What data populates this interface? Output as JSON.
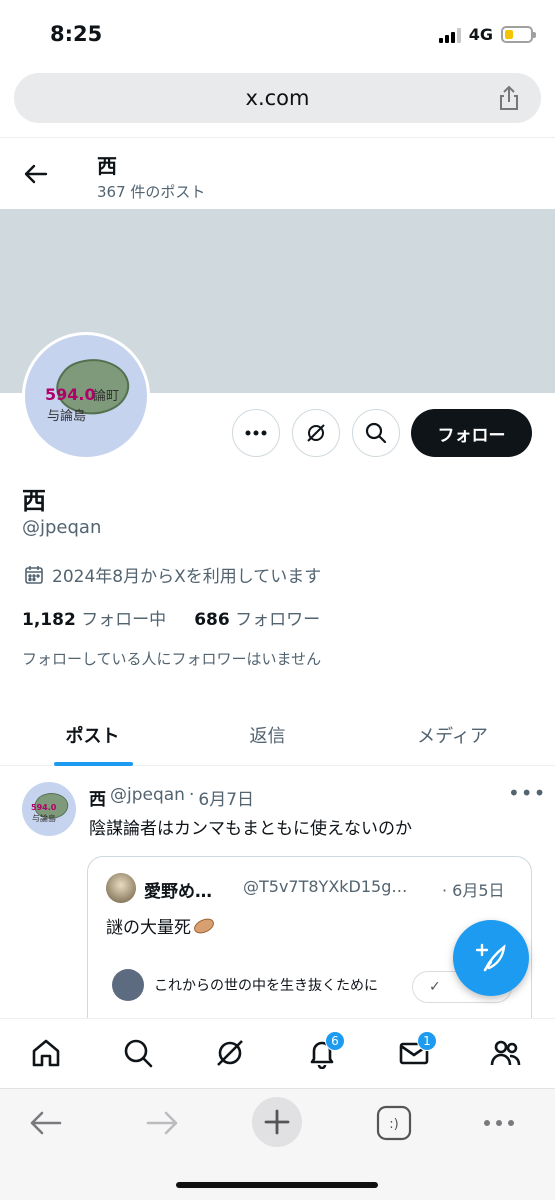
{
  "status_bar": {
    "time": "8:25",
    "network": "4G",
    "battery_percent": 35
  },
  "browser": {
    "url": "x.com"
  },
  "header": {
    "name": "西",
    "post_count": "367 件のポスト"
  },
  "avatar": {
    "number": "594.0",
    "town": "論町",
    "island": "与論島"
  },
  "actions": {
    "follow_label": "フォロー"
  },
  "profile": {
    "name": "西",
    "handle": "@jpeqan",
    "joined": "2024年8月からXを利用しています",
    "following_count": "1,182",
    "following_label": "フォロー中",
    "followers_count": "686",
    "followers_label": "フォロワー",
    "note": "フォローしている人にフォロワーはいません"
  },
  "tabs": [
    {
      "label": "ポスト"
    },
    {
      "label": "返信"
    },
    {
      "label": "メディア"
    }
  ],
  "tweet": {
    "name": "西",
    "handle": "@jpeqan",
    "sep": "·",
    "date": "6月7日",
    "more": "•••",
    "text": "陰謀論者はカンマもまともに使えないのか",
    "quote": {
      "name": "愛野め…",
      "handle": "@T5v7T8YXkD15g…",
      "date": "· 6月5日",
      "text": "謎の大量死",
      "sub_text": "これからの世の中を生き抜くために",
      "check": "✓"
    }
  },
  "bottom_nav": {
    "notifications_badge": "6",
    "messages_badge": "1"
  },
  "colors": {
    "accent": "#1d9bf0",
    "banner": "#cfd9de",
    "text": "#0f1419",
    "muted": "#536471"
  }
}
